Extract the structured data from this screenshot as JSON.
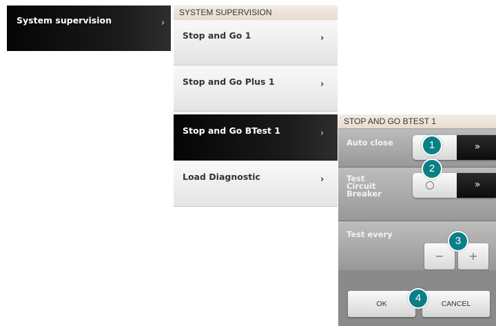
{
  "left_menu": {
    "item_label": "System supervision",
    "chevron": "›"
  },
  "middle_menu": {
    "header": "SYSTEM SUPERVISION",
    "items": [
      {
        "label": "Stop and Go 1",
        "chevron": "›",
        "selected": false
      },
      {
        "label": "Stop and Go Plus 1",
        "chevron": "›",
        "selected": false
      },
      {
        "label": "Stop and Go BTest 1",
        "chevron": "›",
        "selected": true
      },
      {
        "label": "Load Diagnostic",
        "chevron": "›",
        "selected": false
      }
    ]
  },
  "detail_panel": {
    "header": "STOP AND GO BTEST 1",
    "auto_close": {
      "label": "Auto close",
      "knob_symbol": "○",
      "track_symbol": "»"
    },
    "test_circuit_breaker": {
      "label_lines": [
        "Test",
        "Circuit",
        "Breaker"
      ],
      "knob_symbol": "○",
      "track_symbol": "»"
    },
    "test_every": {
      "label": "Test every",
      "minus": "−",
      "plus": "+"
    },
    "footer": {
      "ok": "OK",
      "cancel": "CANCEL"
    }
  },
  "callouts": [
    "1",
    "2",
    "3",
    "4"
  ],
  "colors": {
    "callout": "#0b7f86",
    "selected_item": "#111111",
    "header_bg": "#efe7dc"
  }
}
